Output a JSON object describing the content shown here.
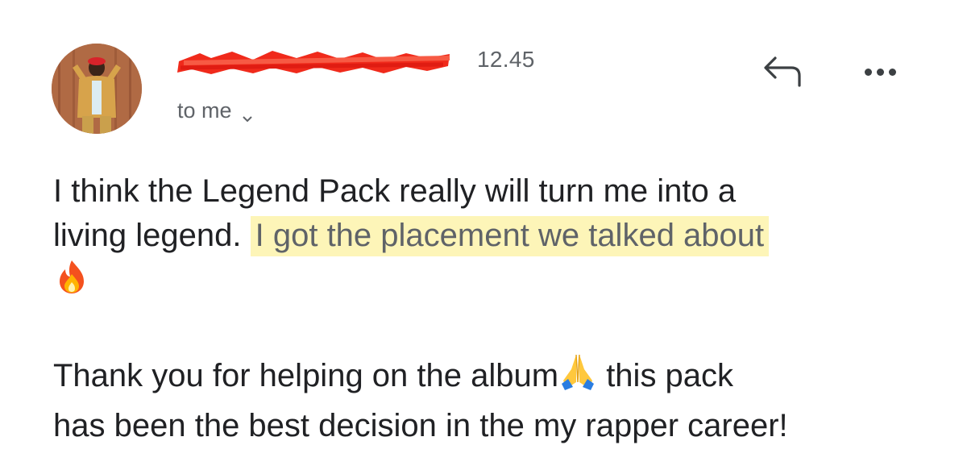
{
  "email": {
    "sender": {
      "avatar_alt": "sender-avatar"
    },
    "time": "12.45",
    "recipient_label": "to me",
    "actions": {
      "reply_icon": "reply-icon",
      "more_icon": "more-horizontal-icon"
    },
    "body": {
      "line1": "I think the Legend Pack really will turn me into a",
      "line2_start": "living legend.",
      "line2_highlight": "I got the placement we talked about",
      "fire_emoji": "fire-emoji",
      "para2_a": "Thank you for helping on the album",
      "pray_emoji": "pray-emoji",
      "para2_b": " this pack",
      "para2_c": "has been the best decision in the my rapper career!"
    },
    "colors": {
      "text": "#202124",
      "muted": "#5f6368",
      "highlight": "#fdf5b8",
      "redaction": "#f02a1b"
    }
  }
}
